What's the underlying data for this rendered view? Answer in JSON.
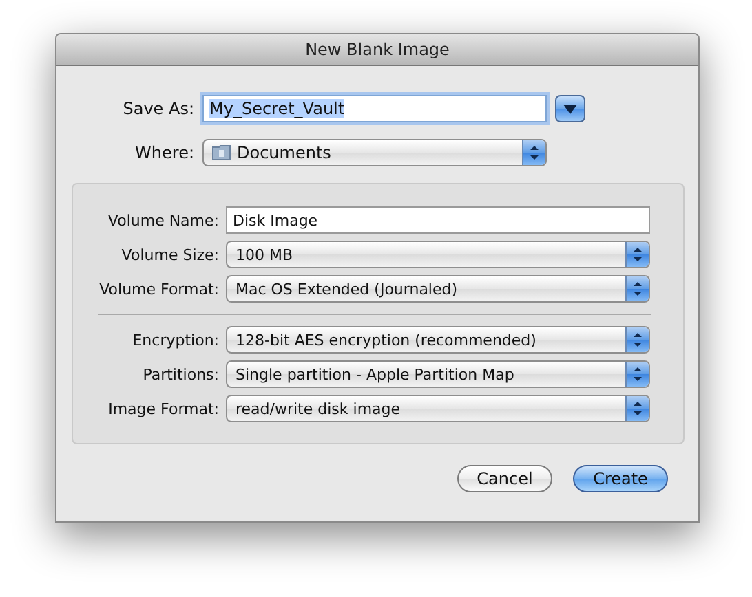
{
  "window": {
    "title": "New Blank Image"
  },
  "save_as": {
    "label": "Save As:",
    "value": "My_Secret_Vault",
    "text_selected": true
  },
  "where": {
    "label": "Where:",
    "value": "Documents"
  },
  "options": [
    {
      "label": "Volume Name:",
      "kind": "text",
      "value": "Disk Image"
    },
    {
      "label": "Volume Size:",
      "kind": "popup",
      "value": "100 MB"
    },
    {
      "label": "Volume Format:",
      "kind": "popup",
      "value": "Mac OS Extended (Journaled)"
    },
    {
      "kind": "separator"
    },
    {
      "label": "Encryption:",
      "kind": "popup",
      "value": "128-bit AES encryption (recommended)"
    },
    {
      "label": "Partitions:",
      "kind": "popup",
      "value": "Single partition - Apple Partition Map"
    },
    {
      "label": "Image Format:",
      "kind": "popup",
      "value": "read/write disk image"
    }
  ],
  "buttons": [
    {
      "label": "Cancel",
      "default": false
    },
    {
      "label": "Create",
      "default": true
    }
  ]
}
